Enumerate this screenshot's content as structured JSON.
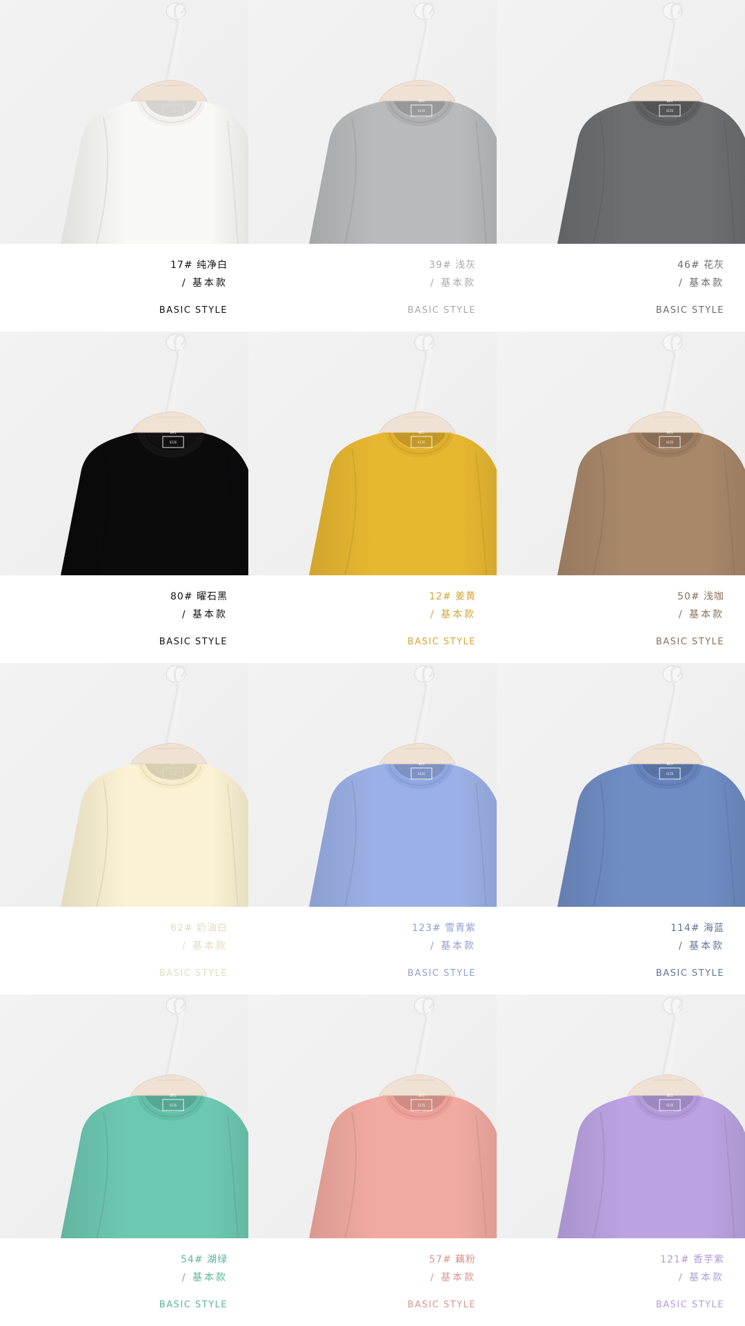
{
  "products": [
    {
      "id": "p1",
      "name": "17# 纯净白",
      "subtitle": "/ 基本款",
      "style": "BASIC STYLE",
      "shirt_color": "#f8f8f4",
      "collar_color": "#f2f1ec",
      "text_color": "#111111",
      "tag": "light",
      "tag_text": [
        "BKS",
        "SIZE"
      ]
    },
    {
      "id": "p2",
      "name": "39# 浅灰",
      "subtitle": "/ 基本款",
      "style": "BASIC STYLE",
      "shirt_color": "#b9babb",
      "collar_color": "#adaeb0",
      "text_color": "#a9a9a9",
      "tag": "on",
      "tag_text": [
        "BKS",
        "SIZE"
      ]
    },
    {
      "id": "p3",
      "name": "46# 花灰",
      "subtitle": "/ 基本款",
      "style": "BASIC STYLE",
      "shirt_color": "#6d6e70",
      "collar_color": "#5f6062",
      "text_color": "#6a6a6a",
      "tag": "on",
      "tag_text": [
        "BKS",
        "SIZE"
      ]
    },
    {
      "id": "p4",
      "name": "80# 曜石黑",
      "subtitle": "/ 基本款",
      "style": "BASIC STYLE",
      "shirt_color": "#0b0b0c",
      "collar_color": "#151516",
      "text_color": "#111111",
      "tag": "on",
      "tag_text": [
        "BKS",
        "SIZE"
      ]
    },
    {
      "id": "p5",
      "name": "12# 姜黄",
      "subtitle": "/ 基本款",
      "style": "BASIC STYLE",
      "shirt_color": "#e8b731",
      "collar_color": "#dfae2c",
      "text_color": "#d4a536",
      "tag": "on",
      "tag_text": [
        "BKS",
        "SIZE"
      ]
    },
    {
      "id": "p6",
      "name": "50# 浅咖",
      "subtitle": "/ 基本款",
      "style": "BASIC STYLE",
      "shirt_color": "#a8876a",
      "collar_color": "#9d7d61",
      "text_color": "#8a6f58",
      "tag": "on",
      "tag_text": [
        "BKS",
        "SIZE"
      ]
    },
    {
      "id": "p7",
      "name": "62# 奶油白",
      "subtitle": "/ 基本款",
      "style": "BASIC STYLE",
      "shirt_color": "#fbf2d3",
      "collar_color": "#f6ecc9",
      "text_color": "#e3dbbe",
      "tag": "light",
      "tag_text": [
        "BKS",
        "SIZE"
      ]
    },
    {
      "id": "p8",
      "name": "123# 雪青紫",
      "subtitle": "/ 基本款",
      "style": "BASIC STYLE",
      "shirt_color": "#9bb0e6",
      "collar_color": "#90a6df",
      "text_color": "#8e9fce",
      "tag": "on",
      "tag_text": [
        "BKS",
        "SIZE"
      ]
    },
    {
      "id": "p9",
      "name": "114# 海蓝",
      "subtitle": "/ 基本款",
      "style": "BASIC STYLE",
      "shirt_color": "#6f8cc3",
      "collar_color": "#6582bb",
      "text_color": "#5f7596",
      "tag": "on",
      "tag_text": [
        "BKS",
        "SIZE"
      ]
    },
    {
      "id": "p10",
      "name": "54# 湖绿",
      "subtitle": "/ 基本款",
      "style": "BASIC STYLE",
      "shirt_color": "#6dc8b2",
      "collar_color": "#63bea8",
      "text_color": "#5bb39f",
      "tag": "on",
      "tag_text": [
        "BKS",
        "SIZE"
      ]
    },
    {
      "id": "p11",
      "name": "57# 藕粉",
      "subtitle": "/ 基本款",
      "style": "BASIC STYLE",
      "shirt_color": "#f1aaa1",
      "collar_color": "#eba097",
      "text_color": "#d9968d",
      "tag": "on",
      "tag_text": [
        "BKS",
        "SIZE"
      ]
    },
    {
      "id": "p12",
      "name": "121# 香芋紫",
      "subtitle": "/ 基本款",
      "style": "BASIC STYLE",
      "shirt_color": "#bba3e2",
      "collar_color": "#b29ad9",
      "text_color": "#b29bd6",
      "tag": "on",
      "tag_text": [
        "BKS",
        "SIZE"
      ]
    }
  ],
  "colors": {
    "wall": "#ececec",
    "hanger_wood": "#efe1d4",
    "hook": "#f6f6f6"
  }
}
